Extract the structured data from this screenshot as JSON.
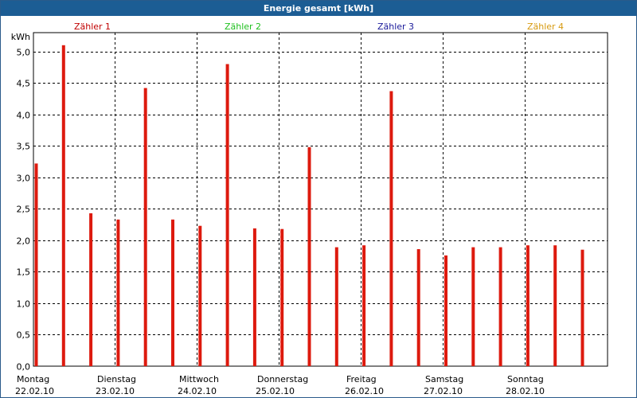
{
  "window": {
    "title": "Energie gesamt [kWh]"
  },
  "colors": {
    "bar": "#dd1a0e",
    "title_bg": "#1c5d94",
    "legend": [
      "#c00000",
      "#1fc01f",
      "#1a1a9a",
      "#d79a10"
    ]
  },
  "chart_data": {
    "type": "bar",
    "title": "Energie gesamt [kWh]",
    "ylabel": "kWh",
    "xlabel": "",
    "ylim": [
      0,
      5.3
    ],
    "grid": true,
    "yticks": [
      "0,0",
      "0,5",
      "1,0",
      "1,5",
      "2,0",
      "2,5",
      "3,0",
      "3,5",
      "4,0",
      "4,5",
      "5,0"
    ],
    "legend": [
      "Zähler 1",
      "Zähler 2",
      "Zähler 3",
      "Zähler 4"
    ],
    "legend_placement": "top",
    "days": [
      {
        "name": "Montag",
        "date": "22.02.10"
      },
      {
        "name": "Dienstag",
        "date": "23.02.10"
      },
      {
        "name": "Mittwoch",
        "date": "24.02.10"
      },
      {
        "name": "Donnerstag",
        "date": "25.02.10"
      },
      {
        "name": "Freitag",
        "date": "26.02.10"
      },
      {
        "name": "Samstag",
        "date": "27.02.10"
      },
      {
        "name": "Sonntag",
        "date": "28.02.10"
      }
    ],
    "series": [
      {
        "name": "Zähler 1",
        "values": [
          3.22,
          5.1,
          2.43,
          2.33,
          4.42,
          2.33,
          2.23,
          4.8,
          2.19,
          2.18,
          3.48,
          1.89,
          1.92,
          4.37,
          1.86,
          1.76,
          1.89,
          1.89,
          1.92,
          1.92,
          1.85
        ]
      }
    ]
  }
}
